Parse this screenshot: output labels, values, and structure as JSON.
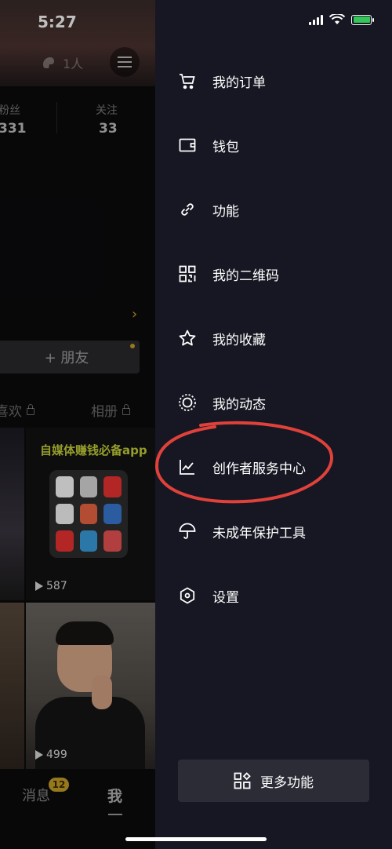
{
  "status_bar": {
    "time": "5:27"
  },
  "profile": {
    "visitors": "1人",
    "stats": [
      {
        "label": "粉丝",
        "value": "331"
      },
      {
        "label": "关注",
        "value": "33"
      }
    ],
    "add_friend_label": "+ 朋友",
    "tabs": [
      {
        "label": "喜欢",
        "locked": true
      },
      {
        "label": "相册",
        "locked": true
      }
    ],
    "videos": [
      {
        "title": "自媒体赚钱必备app",
        "plays": "587"
      },
      {
        "title": "",
        "plays": "499"
      }
    ]
  },
  "bottom_nav": {
    "messages_label": "消息",
    "messages_badge": "12",
    "me_label": "我"
  },
  "drawer": {
    "items": [
      {
        "label": "我的订单",
        "icon": "cart-icon"
      },
      {
        "label": "钱包",
        "icon": "wallet-icon"
      },
      {
        "label": "功能",
        "icon": "link-icon"
      },
      {
        "label": "我的二维码",
        "icon": "qrcode-icon"
      },
      {
        "label": "我的收藏",
        "icon": "star-icon"
      },
      {
        "label": "我的动态",
        "icon": "dynamic-icon"
      },
      {
        "label": "创作者服务中心",
        "icon": "chart-icon",
        "highlighted": true
      },
      {
        "label": "未成年保护工具",
        "icon": "umbrella-icon"
      },
      {
        "label": "设置",
        "icon": "settings-icon"
      }
    ],
    "more_label": "更多功能"
  },
  "colors": {
    "drawer_bg": "#161722",
    "accent_gold": "#c9a227",
    "annotation_red": "#e0413a",
    "battery_green": "#33c759"
  }
}
